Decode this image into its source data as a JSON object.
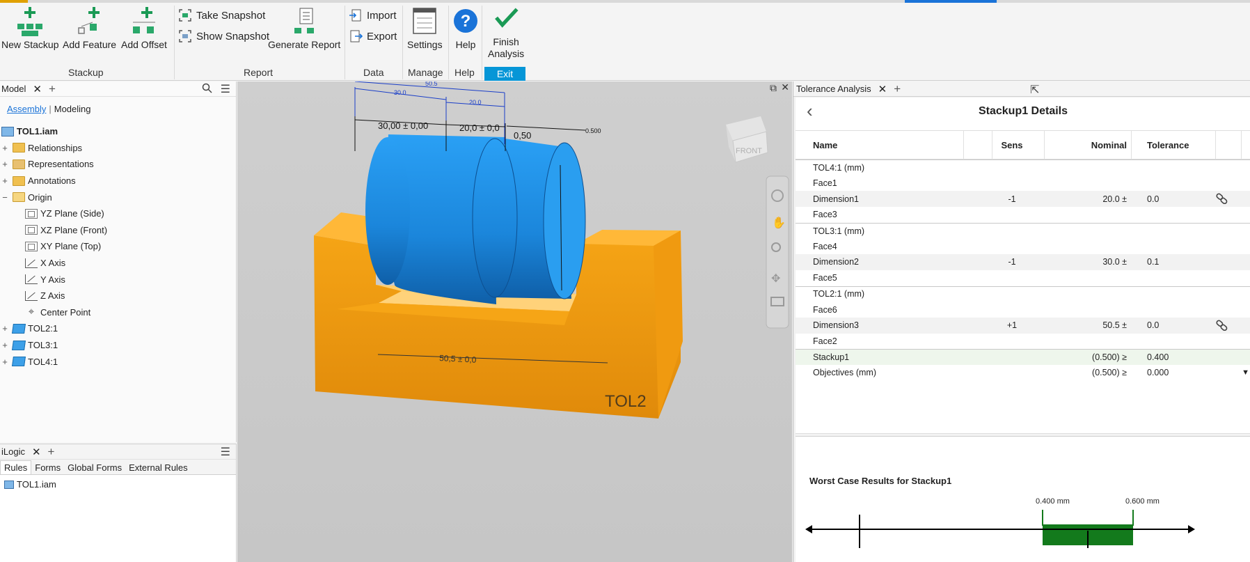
{
  "ribbon": {
    "new_stackup": "New Stackup",
    "add_feature": "Add Feature",
    "add_offset": "Add Offset",
    "take_snapshot": "Take Snapshot",
    "show_snapshot": "Show Snapshot",
    "generate_report": "Generate Report",
    "import": "Import",
    "export": "Export",
    "settings": "Settings",
    "help": "Help",
    "finish_analysis_1": "Finish",
    "finish_analysis_2": "Analysis",
    "groups": {
      "stackup": "Stackup",
      "report": "Report",
      "data": "Data",
      "manage": "Manage",
      "help": "Help",
      "exit": "Exit"
    },
    "accent_color": "#0696d7"
  },
  "model_panel": {
    "tab": "Model",
    "subtabs": [
      "Assembly",
      "Modeling"
    ],
    "root": "TOL1.iam",
    "items": [
      {
        "label": "Relationships",
        "icon": "folder-icon"
      },
      {
        "label": "Representations",
        "icon": "representations-icon"
      },
      {
        "label": "Annotations",
        "icon": "annotations-icon"
      },
      {
        "label": "Origin",
        "icon": "folder-icon"
      },
      {
        "label": "YZ Plane (Side)",
        "icon": "plane-icon"
      },
      {
        "label": "XZ Plane (Front)",
        "icon": "plane-icon"
      },
      {
        "label": "XY Plane (Top)",
        "icon": "plane-icon"
      },
      {
        "label": "X Axis",
        "icon": "axis-icon"
      },
      {
        "label": "Y Axis",
        "icon": "axis-icon"
      },
      {
        "label": "Z Axis",
        "icon": "axis-icon"
      },
      {
        "label": "Center Point",
        "icon": "point-icon"
      },
      {
        "label": "TOL2:1",
        "icon": "part-icon"
      },
      {
        "label": "TOL3:1",
        "icon": "part-icon"
      },
      {
        "label": "TOL4:1",
        "icon": "part-icon"
      }
    ]
  },
  "ilogic": {
    "tab": "iLogic",
    "tabs": [
      "Rules",
      "Forms",
      "Global Forms",
      "External Rules"
    ],
    "root": "TOL1.iam"
  },
  "viewport": {
    "dims": {
      "top_overall": "50.5",
      "top_left": "30.0",
      "top_right": "20.0",
      "dim_left": "30,00 ± 0,00",
      "dim_right": "20,0 ± 0,0",
      "dim_gap": "0,50",
      "dim_gap_small": "0.500",
      "dim_bottom": "50,5 ± 0,0",
      "part_label": "TOL2"
    },
    "viewcube": "FRONT",
    "colors": {
      "cylinder": "#1e90e8",
      "block": "#f5a416"
    }
  },
  "tolerance": {
    "tab": "Tolerance Analysis",
    "title": "Stackup1 Details",
    "columns": [
      "Name",
      "Sens",
      "Nominal",
      "Tolerance"
    ],
    "rows": [
      {
        "name": "TOL4:1 (mm)",
        "sens": "",
        "nominal": "",
        "tol": "",
        "style": "sep"
      },
      {
        "name": "Face1",
        "sens": "",
        "nominal": "",
        "tol": "",
        "style": ""
      },
      {
        "name": "Dimension1",
        "sens": "-1",
        "nominal": "20.0 ±",
        "tol": "0.0",
        "style": "band",
        "link": true
      },
      {
        "name": "Face3",
        "sens": "",
        "nominal": "",
        "tol": "",
        "style": ""
      },
      {
        "name": "TOL3:1 (mm)",
        "sens": "",
        "nominal": "",
        "tol": "",
        "style": "sep"
      },
      {
        "name": "Face4",
        "sens": "",
        "nominal": "",
        "tol": "",
        "style": ""
      },
      {
        "name": "Dimension2",
        "sens": "-1",
        "nominal": "30.0 ±",
        "tol": "0.1",
        "style": "band"
      },
      {
        "name": "Face5",
        "sens": "",
        "nominal": "",
        "tol": "",
        "style": ""
      },
      {
        "name": "TOL2:1 (mm)",
        "sens": "",
        "nominal": "",
        "tol": "",
        "style": "sep"
      },
      {
        "name": "Face6",
        "sens": "",
        "nominal": "",
        "tol": "",
        "style": ""
      },
      {
        "name": "Dimension3",
        "sens": "+1",
        "nominal": "50.5 ±",
        "tol": "0.0",
        "style": "band",
        "link": true
      },
      {
        "name": "Face2",
        "sens": "",
        "nominal": "",
        "tol": "",
        "style": ""
      },
      {
        "name": "Stackup1",
        "sens": "",
        "nominal": "(0.500) ≥",
        "tol": "0.400",
        "style": "green sep"
      },
      {
        "name": "Objectives (mm)",
        "sens": "",
        "nominal": "(0.500) ≥",
        "tol": "0.000",
        "style": "",
        "dropdown": true
      }
    ],
    "results_title": "Worst Case Results for Stackup1",
    "range_min_label": "0.400 mm",
    "range_max_label": "0.600 mm",
    "range_color": "#137a1c"
  }
}
